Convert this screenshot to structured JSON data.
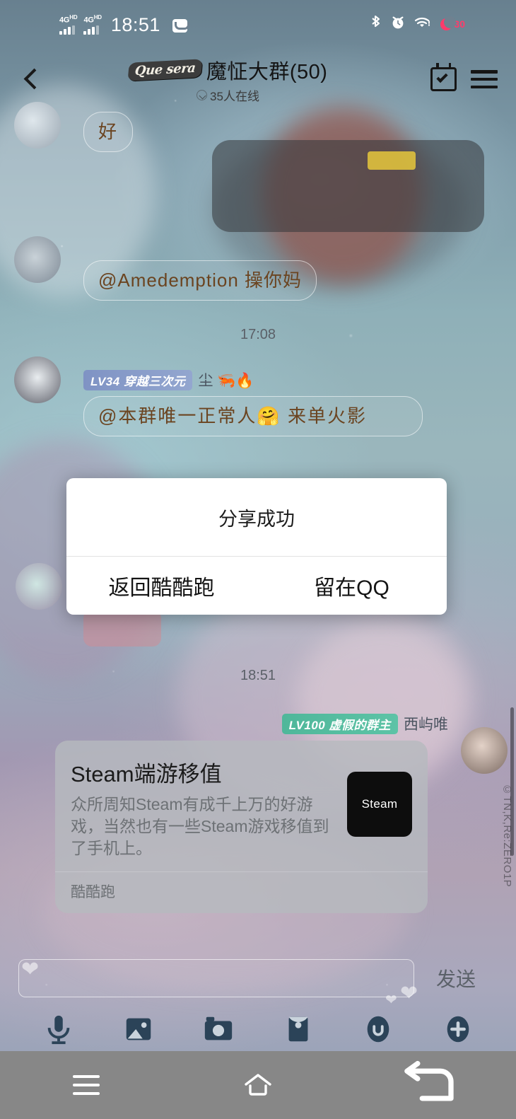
{
  "status_bar": {
    "network_1": "4G",
    "network_1_sup": "HD",
    "network_2": "4G",
    "network_2_sup": "HD",
    "clock": "18:51",
    "mail_icon": "mail-icon",
    "bluetooth_icon": "bluetooth-icon",
    "alarm_icon": "alarm-icon",
    "wifi_icon": "wifi-icon",
    "battery_level": "30",
    "battery_icon": "battery-saver-moon-icon",
    "battery_color": "#ff3b6b"
  },
  "header": {
    "back_icon": "back-chevron-icon",
    "group_badge": "Que sera",
    "title": "魔怔大群(50)",
    "online_status": "35人在线",
    "calendar_icon": "calendar-check-icon",
    "menu_icon": "hamburger-menu-icon"
  },
  "chat": {
    "messages": [
      {
        "id": "msg-hao",
        "text": "好"
      },
      {
        "id": "msg-mention",
        "text": "@Amedemption 操你妈"
      },
      {
        "id": "msg-normal-person",
        "text": "@本群唯一正常人🤗 来单火影"
      }
    ],
    "timestamps": [
      "17:08",
      "18:51"
    ],
    "senders": [
      {
        "level": "LV34",
        "title": "穿越三次元",
        "nickname": "尘 🦐🔥",
        "badge_color": "#8396c6"
      },
      {
        "level": "LV100",
        "title": "虚假的群主",
        "nickname": "西屿唯",
        "badge_color": "#52bca0"
      }
    ]
  },
  "share_card": {
    "title": "Steam端游移值",
    "description": "众所周知Steam有成千上万的好游戏，当然也有一些Steam游戏移值到了手机上。",
    "thumbnail_label": "Steam",
    "source": "酷酷跑"
  },
  "dialog": {
    "message": "分享成功",
    "primary_button": "返回酷酷跑",
    "secondary_button": "留在QQ"
  },
  "input_bar": {
    "input_value": "",
    "input_placeholder": "",
    "send_label": "发送",
    "tools": [
      {
        "name": "voice-icon",
        "label": "语音"
      },
      {
        "name": "image-icon",
        "label": "图片"
      },
      {
        "name": "camera-icon",
        "label": "拍照"
      },
      {
        "name": "red-envelope-icon",
        "label": "红包"
      },
      {
        "name": "emoji-icon",
        "label": "表情"
      },
      {
        "name": "plus-icon",
        "label": "更多"
      }
    ]
  },
  "nav_bar": {
    "recents_icon": "recents-menu-icon",
    "home_icon": "home-icon",
    "back_icon": "back-arrow-icon"
  },
  "watermark": "©TN,K,Re:ZERO1P"
}
